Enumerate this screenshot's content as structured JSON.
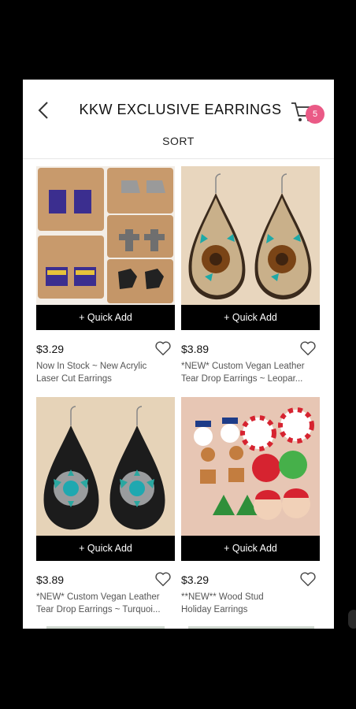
{
  "header": {
    "title": "KKW EXCLUSIVE EARRINGS",
    "cart_count": "5",
    "sort_label": "SORT",
    "back_icon": "chevron-left-icon",
    "cart_icon": "cart-icon"
  },
  "products": [
    {
      "price": "$3.29",
      "quick_add": "+ Quick Add",
      "line1": "Now In Stock ~ New Acrylic",
      "line2": "Laser Cut Earrings"
    },
    {
      "price": "$3.89",
      "quick_add": "+ Quick Add",
      "line1": "*NEW* Custom Vegan Leather",
      "line2": "Tear Drop Earrings ~ Leopar..."
    },
    {
      "price": "$3.89",
      "quick_add": "+ Quick Add",
      "line1": "*NEW* Custom Vegan Leather",
      "line2": "Tear Drop Earrings ~ Turquoi..."
    },
    {
      "price": "$3.29",
      "quick_add": "+ Quick Add",
      "line1": "**NEW** Wood Stud",
      "line2": "Holiday Earrings"
    }
  ],
  "colors": {
    "badge": "#ea5a86",
    "quick_add_bg": "#000000",
    "frame": "#000000"
  }
}
